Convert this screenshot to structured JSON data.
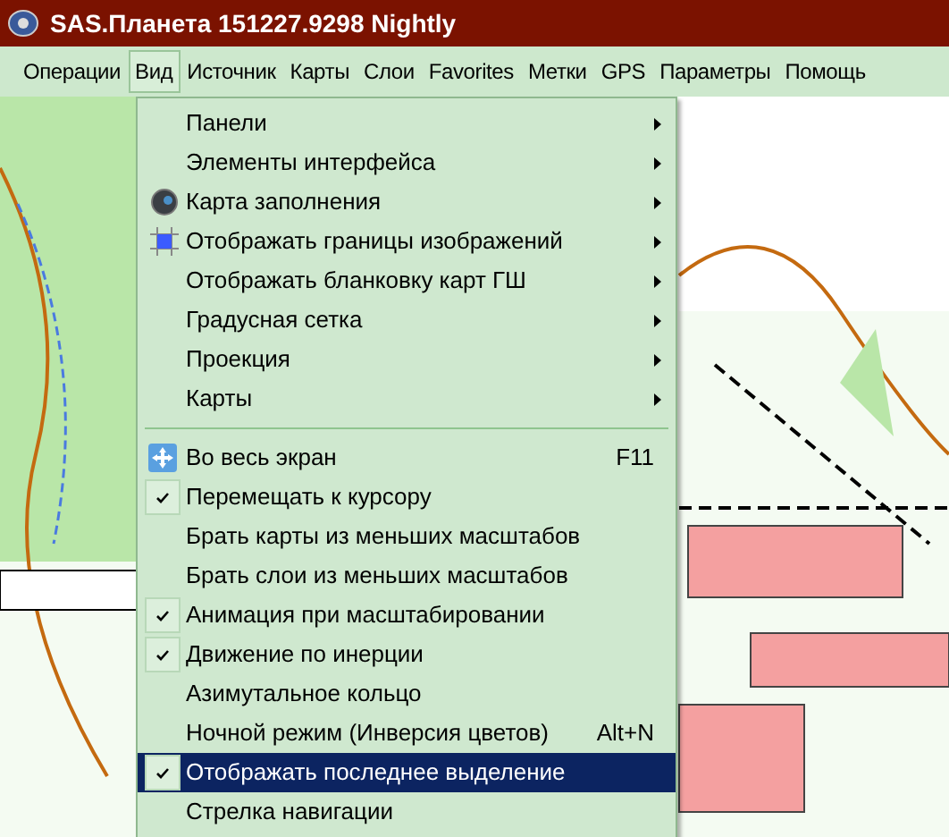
{
  "window": {
    "title": "SAS.Планета 151227.9298 Nightly"
  },
  "menu_bar": [
    {
      "label": "Операции",
      "selected": false
    },
    {
      "label": "Вид",
      "selected": true
    },
    {
      "label": "Источник",
      "selected": false
    },
    {
      "label": "Карты",
      "selected": false
    },
    {
      "label": "Слои",
      "selected": false
    },
    {
      "label": "Favorites",
      "selected": false
    },
    {
      "label": "Метки",
      "selected": false
    },
    {
      "label": "GPS",
      "selected": false
    },
    {
      "label": "Параметры",
      "selected": false
    },
    {
      "label": "Помощь",
      "selected": false
    }
  ],
  "dropdown": [
    {
      "kind": "submenu",
      "label": "Панели"
    },
    {
      "kind": "submenu",
      "label": "Элементы интерфейса"
    },
    {
      "kind": "submenu",
      "label": "Карта заполнения"
    },
    {
      "kind": "submenu",
      "label": "Отображать границы изображений"
    },
    {
      "kind": "submenu",
      "label": "Отображать бланковку карт ГШ"
    },
    {
      "kind": "submenu",
      "label": "Градусная сетка"
    },
    {
      "kind": "submenu",
      "label": "Проекция"
    },
    {
      "kind": "submenu",
      "label": "Карты"
    },
    {
      "kind": "separator"
    },
    {
      "kind": "command",
      "label": "Во весь экран",
      "shortcut": "F11",
      "checked": false,
      "selected": false
    },
    {
      "kind": "command",
      "label": "Перемещать к курсору",
      "checked": true,
      "selected": false
    },
    {
      "kind": "command",
      "label": "Брать карты из меньших масштабов",
      "checked": false,
      "selected": false
    },
    {
      "kind": "command",
      "label": "Брать слои из меньших масштабов",
      "checked": false,
      "selected": false
    },
    {
      "kind": "command",
      "label": "Анимация при масштабировании",
      "checked": true,
      "selected": false
    },
    {
      "kind": "command",
      "label": "Движение по инерции",
      "checked": true,
      "selected": false
    },
    {
      "kind": "command",
      "label": "Азимутальное кольцо",
      "checked": false,
      "selected": false
    },
    {
      "kind": "command",
      "label": "Ночной режим (Инверсия цветов)",
      "shortcut": "Alt+N",
      "checked": false,
      "selected": false
    },
    {
      "kind": "command",
      "label": "Отображать последнее выделение",
      "checked": true,
      "selected": true
    },
    {
      "kind": "command",
      "label": "Стрелка навигации",
      "checked": false,
      "selected": false
    }
  ]
}
